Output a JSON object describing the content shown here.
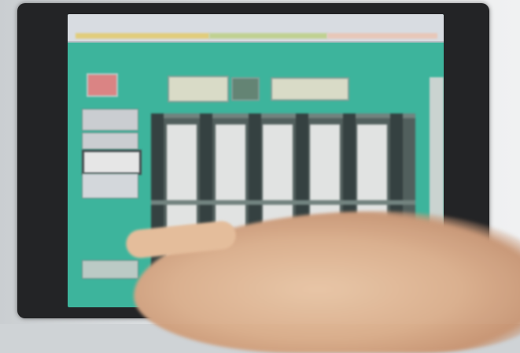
{
  "photo": {
    "subject": "",
    "colors": {
      "screen_bg": "#37b299",
      "bezel": "#1c1d1f",
      "red_button": "#d98080",
      "blue_button": "#3a6ad0"
    }
  }
}
